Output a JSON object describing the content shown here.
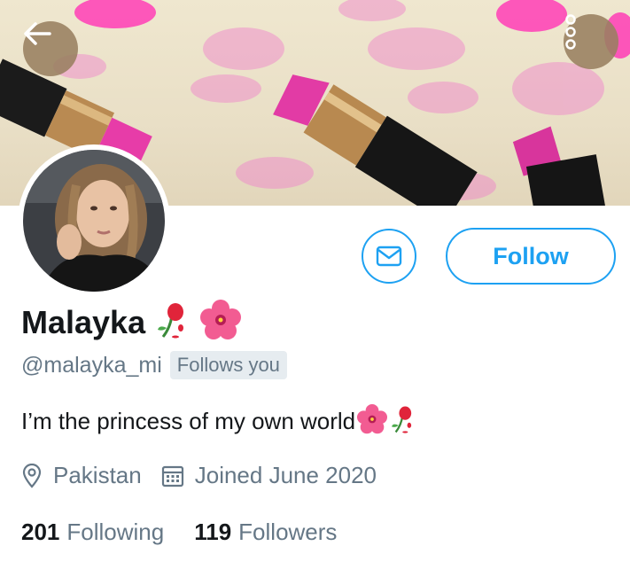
{
  "profile": {
    "name": "Malayka",
    "handle": "@malayka_mi",
    "follows_badge": "Follows you",
    "bio": "I’m the princess of my own world",
    "location": "Pakistan",
    "joined": "Joined June 2020",
    "following_count": "201",
    "following_label": "Following",
    "followers_count": "119",
    "followers_label": "Followers"
  },
  "actions": {
    "follow_label": "Follow"
  },
  "icons": {
    "back": "arrow-left-icon",
    "more": "more-vertical-icon",
    "mail": "mail-icon",
    "location": "location-pin-icon",
    "calendar": "calendar-icon"
  },
  "colors": {
    "accent": "#1da1f2",
    "secondary_text": "#657786",
    "primary_text": "#14171a"
  }
}
